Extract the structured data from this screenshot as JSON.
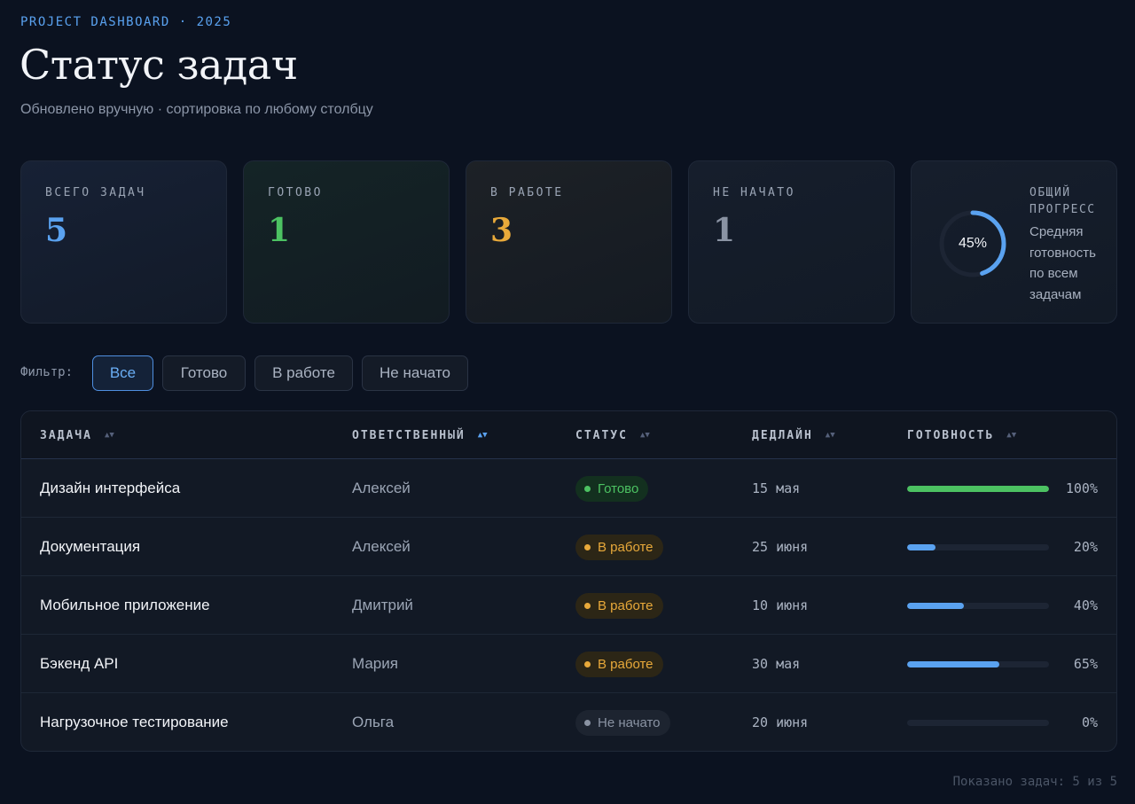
{
  "header": {
    "eyebrow": "PROJECT DASHBOARD · 2025",
    "title": "Статус задач",
    "subtitle": "Обновлено вручную · сортировка по любому столбцу"
  },
  "stats": [
    {
      "label": "ВСЕГО ЗАДАЧ",
      "value": "5",
      "color": "#5aa2f0"
    },
    {
      "label": "ГОТОВО",
      "value": "1",
      "color": "#4cc262"
    },
    {
      "label": "В РАБОТЕ",
      "value": "3",
      "color": "#e8a93a"
    },
    {
      "label": "НЕ НАЧАТО",
      "value": "1",
      "color": "#8a93a3"
    }
  ],
  "overall": {
    "label": "ОБЩИЙ ПРОГРЕСС",
    "description": "Средняя готовность по всем задачам",
    "percent_text": "45%",
    "percent": 45,
    "color": "#5aa2f0"
  },
  "filter": {
    "label": "Фильтр:",
    "options": [
      "Все",
      "Готово",
      "В работе",
      "Не начато"
    ],
    "selected": "Все"
  },
  "table": {
    "columns": [
      "ЗАДАЧА",
      "ОТВЕТСТВЕННЫЙ",
      "СТАТУС",
      "ДЕДЛАЙН",
      "ГОТОВНОСТЬ"
    ],
    "sorted_column": "ОТВЕТСТВЕННЫЙ",
    "rows": [
      {
        "task": "Дизайн интерфейса",
        "owner": "Алексей",
        "status": "Готово",
        "status_kind": "done",
        "deadline": "15 мая",
        "progress": 100,
        "progress_text": "100%",
        "bar_color": "#4cc262"
      },
      {
        "task": "Документация",
        "owner": "Алексей",
        "status": "В работе",
        "status_kind": "work",
        "deadline": "25 июня",
        "progress": 20,
        "progress_text": "20%",
        "bar_color": "#5aa2f0"
      },
      {
        "task": "Мобильное приложение",
        "owner": "Дмитрий",
        "status": "В работе",
        "status_kind": "work",
        "deadline": "10 июня",
        "progress": 40,
        "progress_text": "40%",
        "bar_color": "#5aa2f0"
      },
      {
        "task": "Бэкенд API",
        "owner": "Мария",
        "status": "В работе",
        "status_kind": "work",
        "deadline": "30 мая",
        "progress": 65,
        "progress_text": "65%",
        "bar_color": "#5aa2f0"
      },
      {
        "task": "Нагрузочное тестирование",
        "owner": "Ольга",
        "status": "Не начато",
        "status_kind": "none",
        "deadline": "20 июня",
        "progress": 0,
        "progress_text": "0%",
        "bar_color": "#5aa2f0"
      }
    ]
  },
  "footer": {
    "text": "Показано задач: 5 из 5"
  }
}
